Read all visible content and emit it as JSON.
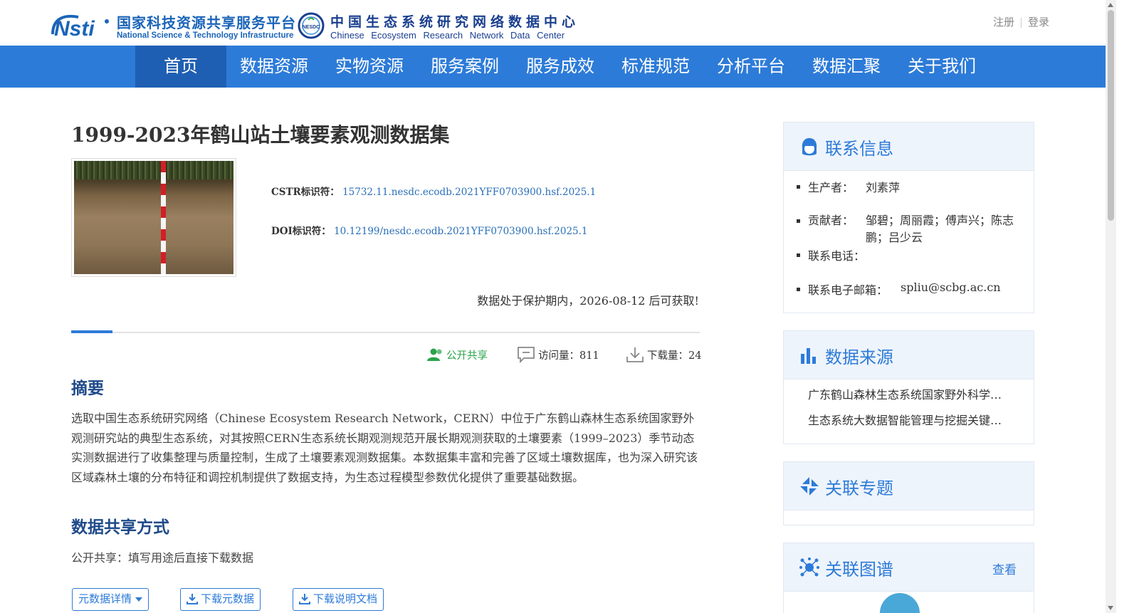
{
  "header": {
    "logo_nsti_cn": "国家科技资源共享服务平台",
    "logo_nsti_en": "National Science & Technology Infrastructure",
    "logo_nesdc_badge": "NESDC",
    "logo_nesdc_cn": "中国生态系统研究网络数据中心",
    "logo_nesdc_en": "Chinese Ecosystem Research Network Data Center",
    "register": "注册",
    "login": "登录"
  },
  "nav": {
    "items": [
      {
        "label": "首页"
      },
      {
        "label": "数据资源"
      },
      {
        "label": "实物资源"
      },
      {
        "label": "服务案例"
      },
      {
        "label": "服务成效"
      },
      {
        "label": "标准规范"
      },
      {
        "label": "分析平台"
      },
      {
        "label": "数据汇聚"
      },
      {
        "label": "关于我们"
      }
    ]
  },
  "dataset": {
    "title": "1999-2023年鹤山站土壤要素观测数据集",
    "cstr_label": "CSTR标识符：",
    "cstr_value": "15732.11.nesdc.ecodb.2021YFF0703900.hsf.2025.1",
    "doi_label": "DOI标识符：",
    "doi_value": "10.12199/nesdc.ecodb.2021YFF0703900.hsf.2025.1",
    "protection_notice": "数据处于保护期内，2026-08-12 后可获取!"
  },
  "stats": {
    "share": "公开共享",
    "visits": "访问量：811",
    "downloads": "下载量：24"
  },
  "abstract": {
    "heading": "摘要",
    "text": "选取中国生态系统研究网络（Chinese Ecosystem Research Network，CERN）中位于广东鹤山森林生态系统国家野外观测研究站的典型生态系统，对其按照CERN生态系统长期观测规范开展长期观测获取的土壤要素（1999–2023）季节动态实测数据进行了收集整理与质量控制，生成了土壤要素观测数据集。本数据集丰富和完善了区域土壤数据库，也为深入研究该区域森林土壤的分布特征和调控机制提供了数据支持，为生态过程模型参数优化提供了重要基础数据。"
  },
  "sharing": {
    "heading": "数据共享方式",
    "text": "公开共享：填写用途后直接下载数据"
  },
  "buttons": {
    "metadata_details": "元数据详情",
    "download_metadata": "下载元数据",
    "download_doc": "下载说明文档"
  },
  "sidebar": {
    "contact": {
      "title": "联系信息",
      "producer_label": "生产者：",
      "producer_value": "刘素萍",
      "contributors_label": "贡献者：",
      "contributors_value": "邹碧；周丽霞；傅声兴；陈志鹏；吕少云",
      "phone_label": "联系电话：",
      "phone_value": "",
      "email_label": "联系电子邮箱：",
      "email_value": "spliu@scbg.ac.cn"
    },
    "sources": {
      "title": "数据来源",
      "items": [
        "广东鹤山森林生态系统国家野外科学…",
        "生态系统大数据智能管理与挖掘关键…"
      ]
    },
    "topics": {
      "title": "关联专题"
    },
    "graph": {
      "title": "关联图谱",
      "more": "查看"
    }
  },
  "colors": {
    "nav_bg": "#2d7bd8",
    "nav_active": "#1f5fb3",
    "link": "#2a6fb8",
    "share_green": "#2aa44a",
    "heading_blue": "#1f4a8a"
  }
}
